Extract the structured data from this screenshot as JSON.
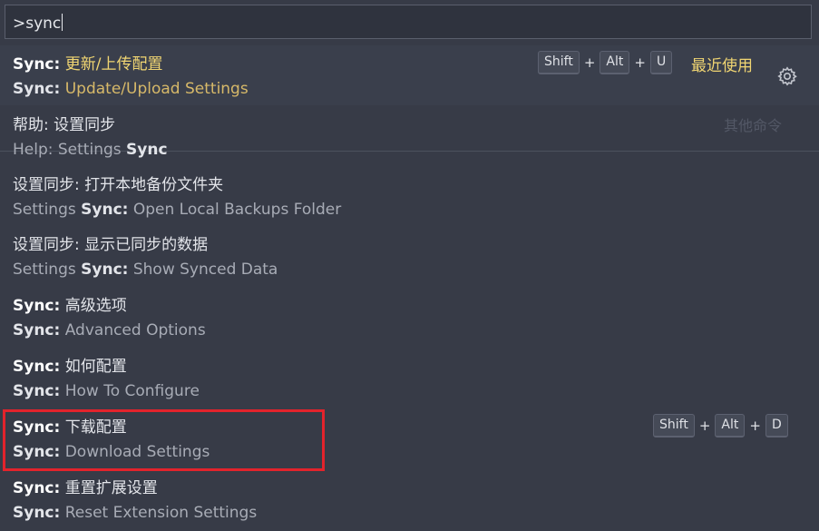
{
  "search": {
    "value": ">sync"
  },
  "items": [
    {
      "prefix": "Sync:",
      "title_zh": "更新/上传配置",
      "prefix2": "Sync:",
      "title_en": "Update/Upload Settings",
      "keys": [
        "Shift",
        "Alt",
        "U"
      ],
      "plus": "+",
      "recent": "最近使用",
      "gear_icon": "gear-icon"
    },
    {
      "title_zh": "帮助: 设置同步",
      "en_pre": "Help: Settings ",
      "en_bold": "Sync",
      "other": "其他命令"
    },
    {
      "title_zh": "设置同步: 打开本地备份文件夹",
      "en_pre": "Settings ",
      "en_bold": "Sync:",
      "en_post": " Open Local Backups Folder"
    },
    {
      "title_zh": "设置同步: 显示已同步的数据",
      "en_pre": "Settings ",
      "en_bold": "Sync:",
      "en_post": " Show Synced Data"
    },
    {
      "prefix": "Sync:",
      "title_zh": " 高级选项",
      "prefix2": "Sync:",
      "title_en": " Advanced Options"
    },
    {
      "prefix": "Sync:",
      "title_zh": " 如何配置",
      "prefix2": "Sync:",
      "title_en": " How To Configure"
    },
    {
      "prefix": "Sync:",
      "title_zh": " 下载配置",
      "prefix2": "Sync:",
      "title_en": " Download Settings",
      "keys": [
        "Shift",
        "Alt",
        "D"
      ],
      "plus": "+"
    },
    {
      "prefix": "Sync:",
      "title_zh": " 重置扩展设置",
      "prefix2": "Sync:",
      "title_en": " Reset Extension Settings"
    }
  ],
  "colors": {
    "accent": "#f0d572",
    "highlight_box": "#e3232c",
    "background": "#373b47"
  }
}
